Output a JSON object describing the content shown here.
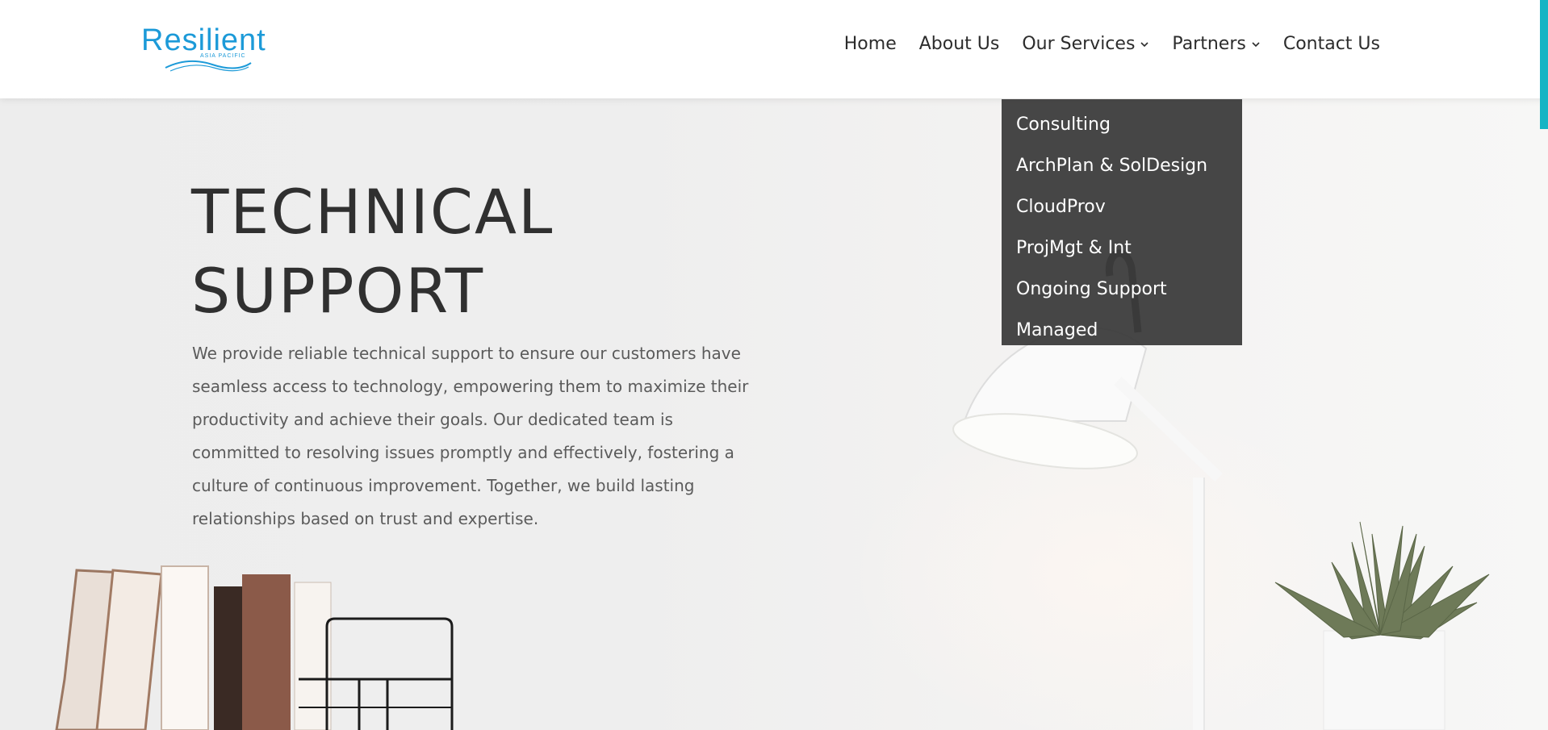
{
  "brand": {
    "name": "Resilient",
    "tagline": "ASIA PACIFIC",
    "color": "#1c9ad8"
  },
  "nav": {
    "items": [
      {
        "label": "Home",
        "has_dropdown": false
      },
      {
        "label": "About Us",
        "has_dropdown": false
      },
      {
        "label": "Our Services",
        "has_dropdown": true
      },
      {
        "label": "Partners",
        "has_dropdown": true
      },
      {
        "label": "Contact Us",
        "has_dropdown": false
      }
    ]
  },
  "services_menu": {
    "items": [
      "Consulting",
      "ArchPlan & SolDesign",
      "CloudProv",
      "ProjMgt & Int",
      "Ongoing Support",
      "Managed"
    ]
  },
  "hero": {
    "title_line1": "TECHNICAL",
    "title_line2": "SUPPORT",
    "description": "We provide reliable technical support to ensure our customers have seamless access to technology, empowering them to maximize their productivity and achieve their goals. Our dedicated team is committed to resolving issues promptly and effectively, fostering a culture of continuous improvement. Together, we build lasting relationships based on trust and expertise."
  },
  "colors": {
    "accent": "#17b4c4",
    "dropdown_bg": "#3a3a3a",
    "title": "#303030",
    "body_text": "#5b5b5b"
  },
  "icons": {
    "dropdown_chevron": "chevron-down-icon"
  }
}
